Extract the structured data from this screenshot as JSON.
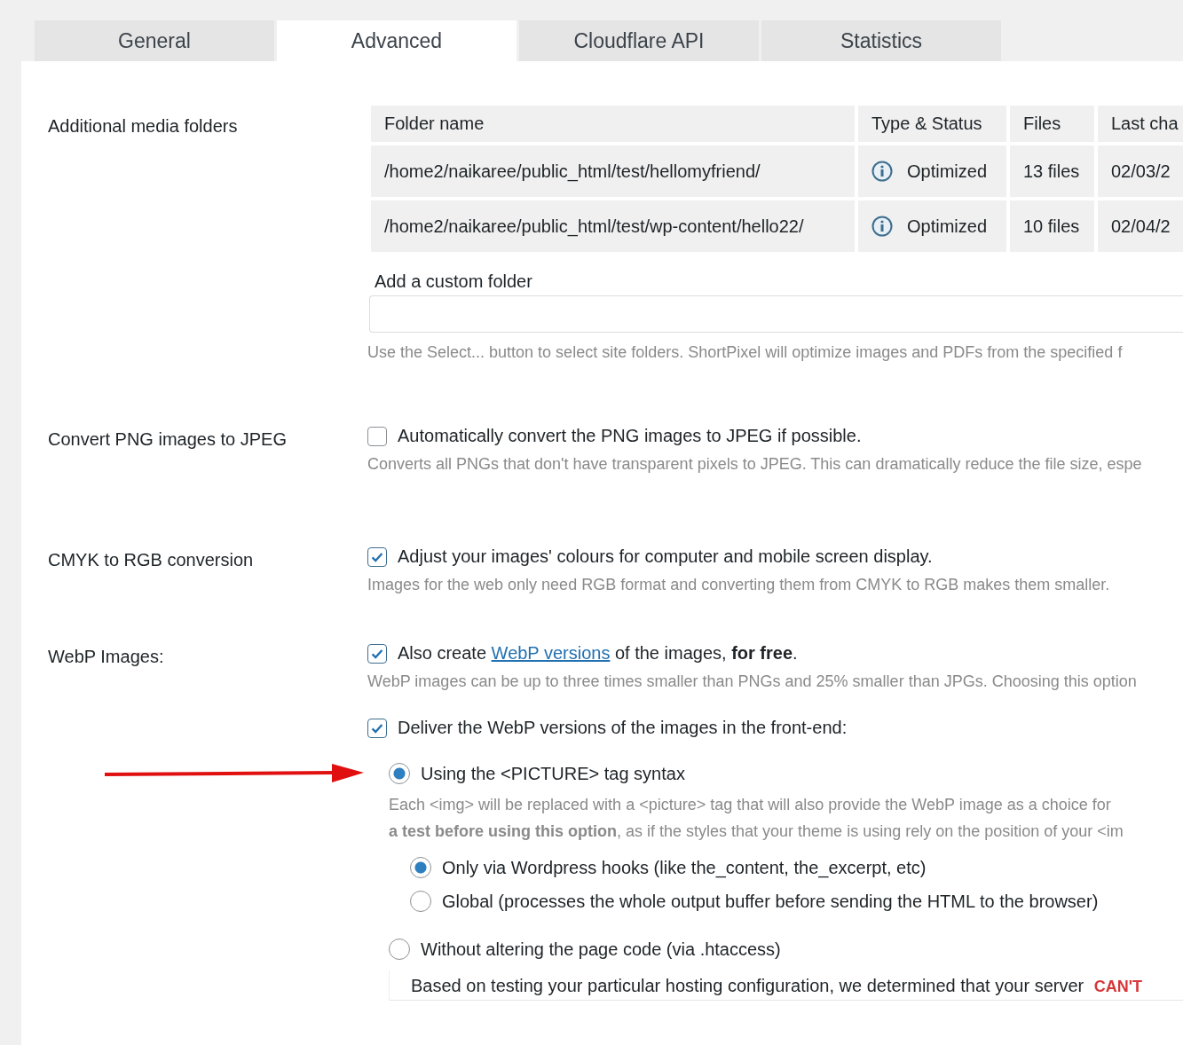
{
  "tabs": [
    {
      "label": "General",
      "selected": false
    },
    {
      "label": "Advanced",
      "selected": true
    },
    {
      "label": "Cloudflare API",
      "selected": false
    },
    {
      "label": "Statistics",
      "selected": false
    }
  ],
  "sections": [
    {
      "kind": "folders",
      "label": "Additional media folders",
      "table": {
        "columns": [
          "Folder name",
          "Type & Status",
          "Files",
          "Last cha"
        ],
        "rows": [
          {
            "folder_name": "/home2/naikaree/public_html/test/hellomyfriend/",
            "type_status": "Optimized",
            "files": "13 files",
            "last_changed": "02/03/2"
          },
          {
            "folder_name": "/home2/naikaree/public_html/test/wp-content/hello22/",
            "type_status": "Optimized",
            "files": "10 files",
            "last_changed": "02/04/2"
          }
        ]
      },
      "custom_folder": {
        "label": "Add a custom folder"
      },
      "description": [
        "Use the Select... button to select site folders. ShortPixel will optimize images and PDFs from the specified f"
      ]
    },
    {
      "kind": "checkbox",
      "label": "Convert PNG images to JPEG",
      "option": {
        "text": "Automatically convert the PNG images to JPEG if possible.",
        "checked": false
      },
      "description": [
        "Converts all PNGs that don't have transparent pixels to JPEG. This can dramatically reduce the file size, espe"
      ]
    },
    {
      "kind": "checkbox",
      "label": "CMYK to RGB conversion",
      "option": {
        "text": "Adjust your images' colours for computer and mobile screen display.",
        "checked": true
      },
      "description": [
        "Images for the web only need RGB format and converting them from CMYK to RGB makes them smaller."
      ]
    },
    {
      "kind": "webp",
      "label": "WebP Images:",
      "option": {
        "text_before": "Also create ",
        "link": "WebP versions",
        "text_after": " of the images, **for free**.",
        "checked": true
      },
      "description": [
        "WebP images can be up to three times smaller than PNGs and 25% smaller than JPGs. Choosing this option"
      ],
      "deliver": {
        "text": "Deliver the WebP versions of the images in the front-end:",
        "checked": true,
        "choices": [
          {
            "text": "Using the <PICTURE> tag syntax",
            "selected": true,
            "arrow": true,
            "description": [
              "Each <img> will be replaced with a <picture> tag that will also provide the WebP image as a choice for",
              "**a test before using this option**, as if the styles that your theme is using rely on the position of your <im"
            ],
            "children": [
              {
                "text": "Only via Wordpress hooks (like the_content, the_excerpt, etc)",
                "selected": true
              },
              {
                "text": "Global (processes the whole output buffer before sending the HTML to the browser)",
                "selected": false
              }
            ]
          },
          {
            "text": "Without altering the page code (via .htaccess)",
            "selected": false,
            "arrow": false,
            "notice": {
              "text": "Based on testing your particular hosting configuration, we determined that your server ",
              "emphasis": "CAN'T"
            }
          }
        ]
      }
    }
  ]
}
